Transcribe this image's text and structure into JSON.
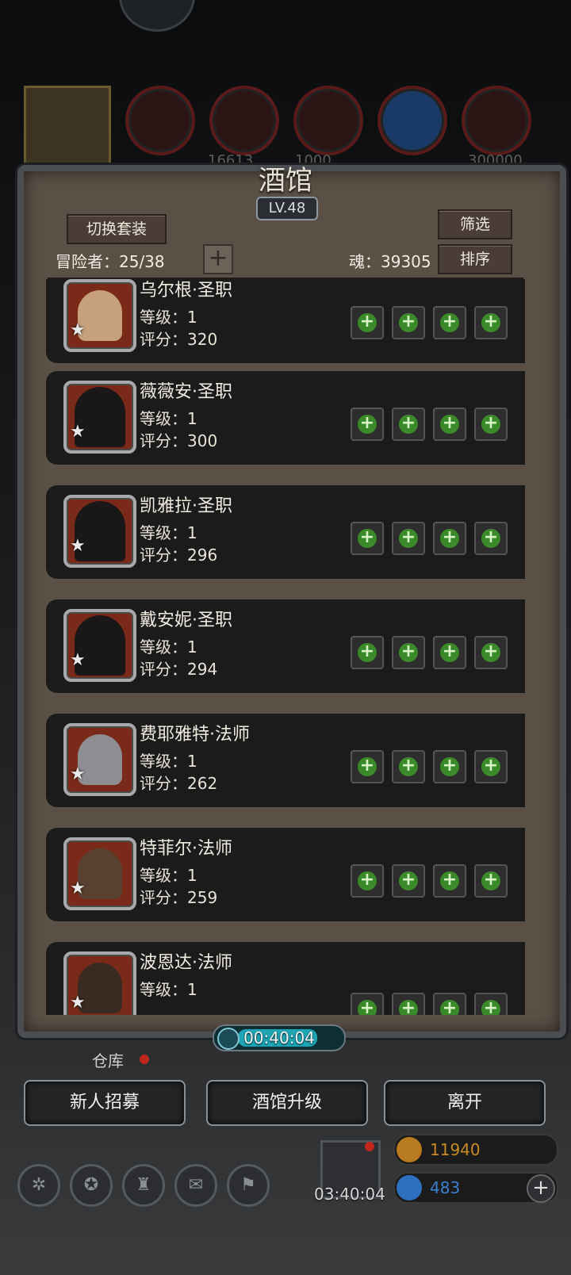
{
  "top_resources": {
    "values": [
      "16613",
      "1000",
      "300000"
    ]
  },
  "tavern": {
    "title": "酒馆",
    "level": "LV.48",
    "switch_outfit_label": "切换套装",
    "filter_label": "筛选",
    "sort_label": "排序",
    "adventurers_label": "冒险者：25/38",
    "add_label": "+",
    "soul_label": "魂：39305"
  },
  "heroes": [
    {
      "name": "乌尔根·圣职",
      "level": "等级：1",
      "score": "评分：320",
      "star": "★"
    },
    {
      "name": "薇薇安·圣职",
      "level": "等级：1",
      "score": "评分：300",
      "star": "★"
    },
    {
      "name": "凯雅拉·圣职",
      "level": "等级：1",
      "score": "评分：296",
      "star": "★"
    },
    {
      "name": "戴安妮·圣职",
      "level": "等级：1",
      "score": "评分：294",
      "star": "★"
    },
    {
      "name": "费耶雅特·法师",
      "level": "等级：1",
      "score": "评分：262",
      "star": "★"
    },
    {
      "name": "特菲尔·法师",
      "level": "等级：1",
      "score": "评分：259",
      "star": "★"
    },
    {
      "name": "波恩达·法师",
      "level": "等级：1",
      "score": "",
      "star": "★"
    }
  ],
  "equip_slot_icons": [
    "add-weapon-icon",
    "add-armor-icon",
    "add-accessory-icon",
    "add-trinket-icon"
  ],
  "timer": "00:40:04",
  "warehouse_label": "仓库",
  "bottom_buttons": {
    "recruit": "新人招募",
    "upgrade": "酒馆升级",
    "leave": "离开"
  },
  "gift_timer": "03:40:04",
  "currencies": {
    "gold": "11940",
    "gem": "483",
    "gem_plus": "+"
  },
  "colors": {
    "gold_text": "#c98a26",
    "gem_text": "#3b7fd0",
    "add_green": "#3b8a2a",
    "badge_red": "#c0261e"
  }
}
